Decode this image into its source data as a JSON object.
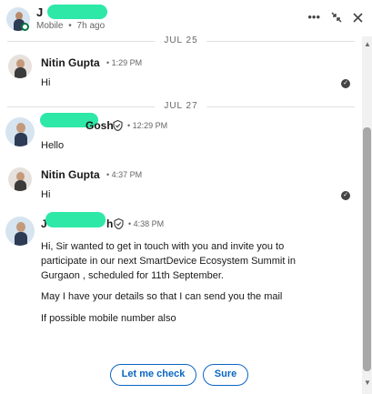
{
  "header": {
    "name_initial": "J",
    "status": "Mobile",
    "separator": "•",
    "last_seen": "7h ago",
    "icons": [
      "more-icon",
      "minimize-icon",
      "close-icon"
    ]
  },
  "dates": [
    "JUL 25",
    "JUL 27"
  ],
  "messages": [
    {
      "sender": "Nitin Gupta",
      "time": "• 1:29 PM",
      "text": "Hi",
      "read": true
    },
    {
      "sender": "Gosh",
      "sender_prefix": "",
      "time": "• 12:29 PM",
      "text": "Hello",
      "verified": true
    },
    {
      "sender": "Nitin Gupta",
      "time": "• 4:37 PM",
      "text": "Hi",
      "read": true
    },
    {
      "sender_prefix": "J",
      "sender": "h",
      "time": "• 4:38 PM",
      "verified": true,
      "texts": [
        "Hi, Sir wanted to get in touch with you and invite you to participate in our next SmartDevice Ecosystem Summit in Gurgaon , scheduled for 11th September.",
        "May I have your details so that I can send you the mail",
        "If possible mobile number also"
      ]
    }
  ],
  "quick_replies": [
    "Let me check",
    "Sure"
  ],
  "colors": {
    "accent": "#0a66c2",
    "online": "#057642",
    "redaction": "#2ee8a8"
  }
}
